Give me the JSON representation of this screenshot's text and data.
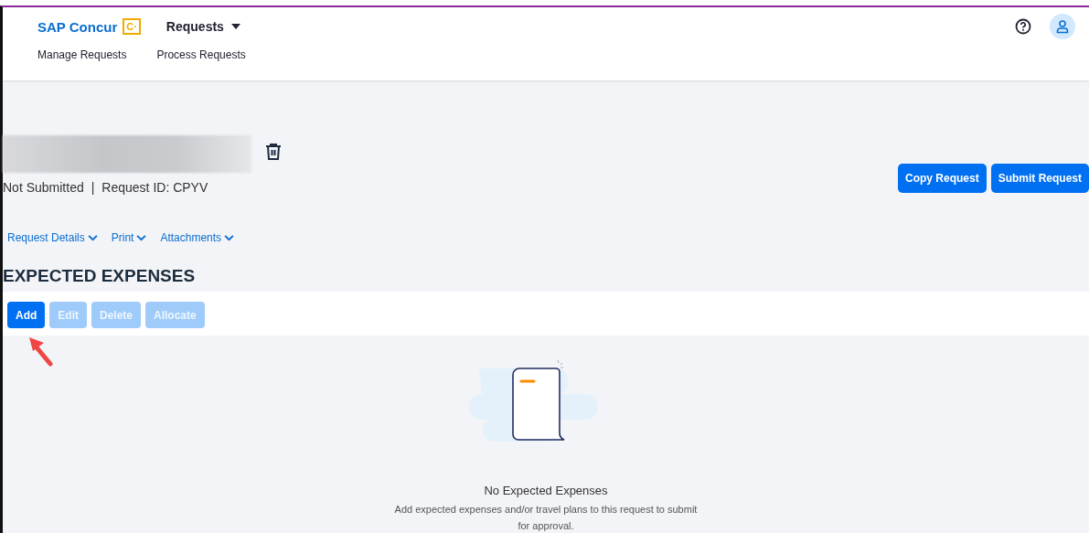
{
  "header": {
    "logo": "SAP Concur",
    "logo_mark": "C·",
    "menu": "Requests",
    "subnav": [
      "Manage Requests",
      "Process Requests"
    ]
  },
  "request": {
    "status": "Not Submitted",
    "separator": "|",
    "request_id": "Request ID: CPYV"
  },
  "actions": [
    {
      "label": "Copy Request"
    },
    {
      "label": "Submit Request"
    }
  ],
  "menus": [
    {
      "label": "Request Details"
    },
    {
      "label": "Print"
    },
    {
      "label": "Attachments"
    }
  ],
  "section": {
    "title": "EXPECTED EXPENSES",
    "toolbar": [
      {
        "label": "Add",
        "disabled": false
      },
      {
        "label": "Edit",
        "disabled": true
      },
      {
        "label": "Delete",
        "disabled": true
      },
      {
        "label": "Allocate",
        "disabled": true
      }
    ],
    "empty": {
      "title": "No Expected Expenses",
      "message": "Add expected expenses and/or travel plans to this request to submit for approval."
    }
  }
}
